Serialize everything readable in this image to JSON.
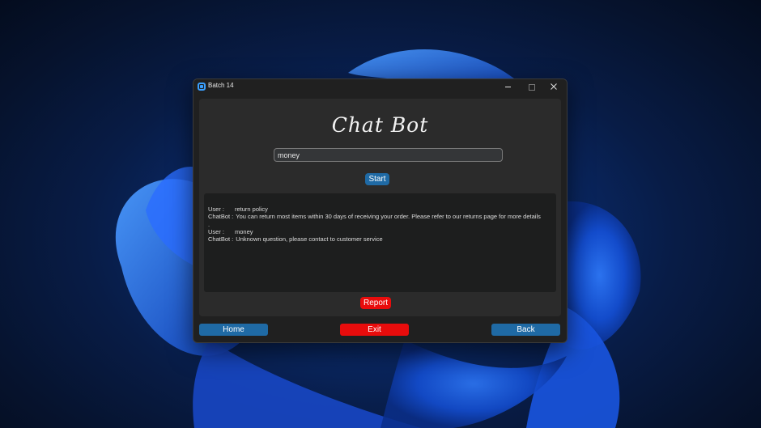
{
  "window": {
    "title": "Batch 14"
  },
  "app": {
    "heading": "Chat Bot",
    "query_value": "money",
    "start_label": "Start",
    "report_label": "Report"
  },
  "chat_log": [
    {
      "speaker": "User :",
      "text": "return policy"
    },
    {
      "speaker": "ChatBot :",
      "text": "You can return most items within 30 days of receiving your order. Please refer to our returns page for more details"
    },
    {
      "speaker": ".",
      "text": ""
    },
    {
      "speaker": "User :",
      "text": "money"
    },
    {
      "speaker": "ChatBot :",
      "text": "Unknown question, please contact to customer service"
    }
  ],
  "nav": {
    "home_label": "Home",
    "exit_label": "Exit",
    "back_label": "Back"
  },
  "colors": {
    "primary_button": "#1f6aa5",
    "danger_button": "#e80c0c",
    "window_bg": "#202020",
    "panel_bg": "#2b2b2b",
    "chat_bg": "#1d1e1e"
  }
}
